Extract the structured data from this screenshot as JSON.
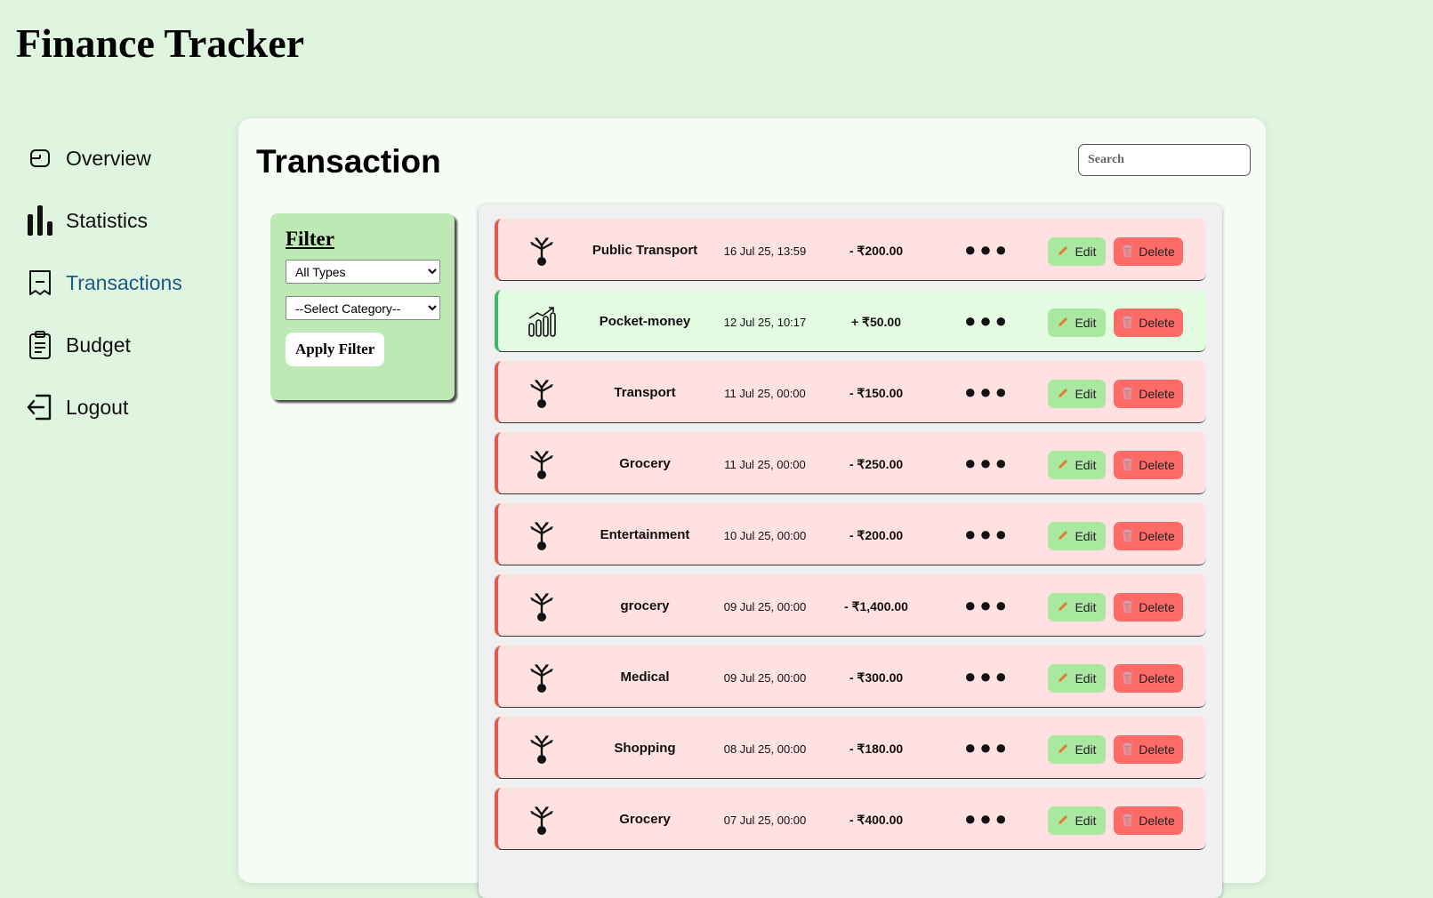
{
  "app": {
    "title": "Finance Tracker"
  },
  "sidebar": {
    "items": [
      {
        "label": "Overview",
        "icon": "overview-icon"
      },
      {
        "label": "Statistics",
        "icon": "bar-chart-icon"
      },
      {
        "label": "Transactions",
        "icon": "receipt-icon",
        "active": true
      },
      {
        "label": "Budget",
        "icon": "clipboard-icon"
      },
      {
        "label": "Logout",
        "icon": "logout-icon"
      }
    ]
  },
  "main": {
    "title": "Transaction",
    "search": {
      "placeholder": "Search",
      "value": ""
    }
  },
  "filter": {
    "title": "Filter",
    "type_select": {
      "selected": "All Types"
    },
    "category_select": {
      "selected": "--Select Category--"
    },
    "apply_label": "Apply Filter"
  },
  "transactions": {
    "edit_label": "Edit",
    "delete_label": "Delete",
    "more_label": "●●●",
    "items": [
      {
        "category": "Public Transport",
        "date": "16 Jul 25, 13:59",
        "amount": "- ₹200.00",
        "type": "expense"
      },
      {
        "category": "Pocket-money",
        "date": "12 Jul 25, 10:17",
        "amount": "+ ₹50.00",
        "type": "income"
      },
      {
        "category": "Transport",
        "date": "11 Jul 25, 00:00",
        "amount": "- ₹150.00",
        "type": "expense"
      },
      {
        "category": "Grocery",
        "date": "11 Jul 25, 00:00",
        "amount": "- ₹250.00",
        "type": "expense"
      },
      {
        "category": "Entertainment",
        "date": "10 Jul 25, 00:00",
        "amount": "- ₹200.00",
        "type": "expense"
      },
      {
        "category": "grocery",
        "date": "09 Jul 25, 00:00",
        "amount": "- ₹1,400.00",
        "type": "expense"
      },
      {
        "category": "Medical",
        "date": "09 Jul 25, 00:00",
        "amount": "- ₹300.00",
        "type": "expense"
      },
      {
        "category": "Shopping",
        "date": "08 Jul 25, 00:00",
        "amount": "- ₹180.00",
        "type": "expense"
      },
      {
        "category": "Grocery",
        "date": "07 Jul 25, 00:00",
        "amount": "- ₹400.00",
        "type": "expense"
      }
    ]
  },
  "colors": {
    "background": "#e0f5e0",
    "expense_row": "#ffe1e1",
    "expense_border": "#e25a4a",
    "income_row": "#e3fbe0",
    "income_border": "#3cb868",
    "edit_button": "#a8e8a0",
    "delete_button": "#fe6b67",
    "active_nav": "#1a5a8a"
  }
}
